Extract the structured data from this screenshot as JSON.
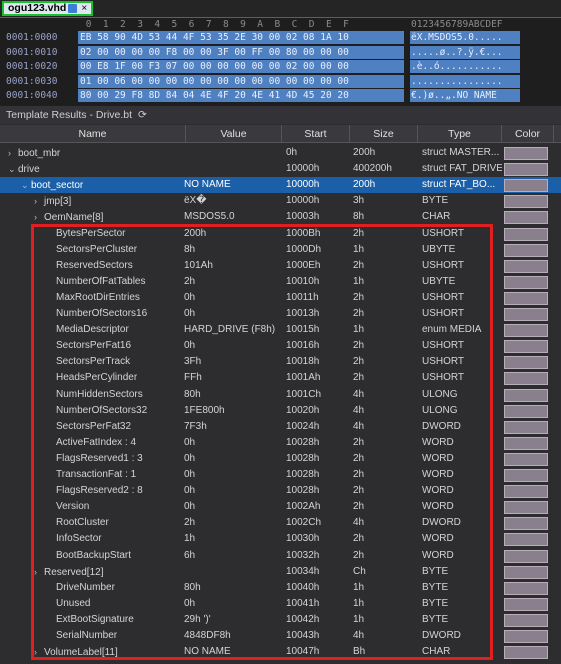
{
  "tab": {
    "label": "ogu123.vhd",
    "close": "×"
  },
  "hex": {
    "header": {
      "addr": "",
      "bytes": " 0  1  2  3  4  5  6  7  8  9  A  B  C  D  E  F",
      "ascii": "0123456789ABCDEF"
    },
    "rows": [
      {
        "addr": "0001:0000",
        "bytes": "EB 58 90 4D 53 44 4F 53 35 2E 30 00 02 08 1A 10",
        "ascii": "ëX.MSDOS5.0....."
      },
      {
        "addr": "0001:0010",
        "bytes": "02 00 00 00 00 F8 00 00 3F 00 FF 00 80 00 00 00",
        "ascii": ".....ø..?.ÿ.€..."
      },
      {
        "addr": "0001:0020",
        "bytes": "00 E8 1F 00 F3 07 00 00 00 00 00 00 02 00 00 00",
        "ascii": ".è..ó..........."
      },
      {
        "addr": "0001:0030",
        "bytes": "01 00 06 00 00 00 00 00 00 00 00 00 00 00 00 00",
        "ascii": "................"
      },
      {
        "addr": "0001:0040",
        "bytes": "80 00 29 F8 8D 84 04 4E 4F 20 4E 41 4D 45 20 20",
        "ascii": "€.)ø..„.NO NAME"
      }
    ]
  },
  "template_title": "Template Results - Drive.bt",
  "columns": [
    "Name",
    "Value",
    "Start",
    "Size",
    "Type",
    "Color"
  ],
  "rows": [
    {
      "indent": 0,
      "chev": "›",
      "name": "boot_mbr",
      "value": "",
      "start": "0h",
      "size": "200h",
      "type": "struct MASTER..."
    },
    {
      "indent": 0,
      "chev": "⌄",
      "name": "drive",
      "value": "",
      "start": "10000h",
      "size": "400200h",
      "type": "struct FAT_DRIVE"
    },
    {
      "indent": 1,
      "chev": "⌄",
      "name": "boot_sector",
      "value": "NO NAME",
      "start": "10000h",
      "size": "200h",
      "type": "struct FAT_BO...",
      "selected": true
    },
    {
      "indent": 2,
      "chev": "›",
      "name": "jmp[3]",
      "value": "ëX�",
      "start": "10000h",
      "size": "3h",
      "type": "BYTE"
    },
    {
      "indent": 2,
      "chev": "›",
      "name": "OemName[8]",
      "value": "MSDOS5.0",
      "start": "10003h",
      "size": "8h",
      "type": "CHAR"
    },
    {
      "indent": 3,
      "chev": "",
      "name": "BytesPerSector",
      "value": "200h",
      "start": "1000Bh",
      "size": "2h",
      "type": "USHORT"
    },
    {
      "indent": 3,
      "chev": "",
      "name": "SectorsPerCluster",
      "value": "8h",
      "start": "1000Dh",
      "size": "1h",
      "type": "UBYTE"
    },
    {
      "indent": 3,
      "chev": "",
      "name": "ReservedSectors",
      "value": "101Ah",
      "start": "1000Eh",
      "size": "2h",
      "type": "USHORT"
    },
    {
      "indent": 3,
      "chev": "",
      "name": "NumberOfFatTables",
      "value": "2h",
      "start": "10010h",
      "size": "1h",
      "type": "UBYTE"
    },
    {
      "indent": 3,
      "chev": "",
      "name": "MaxRootDirEntries",
      "value": "0h",
      "start": "10011h",
      "size": "2h",
      "type": "USHORT"
    },
    {
      "indent": 3,
      "chev": "",
      "name": "NumberOfSectors16",
      "value": "0h",
      "start": "10013h",
      "size": "2h",
      "type": "USHORT"
    },
    {
      "indent": 3,
      "chev": "",
      "name": "MediaDescriptor",
      "value": "HARD_DRIVE (F8h)",
      "start": "10015h",
      "size": "1h",
      "type": "enum MEDIA"
    },
    {
      "indent": 3,
      "chev": "",
      "name": "SectorsPerFat16",
      "value": "0h",
      "start": "10016h",
      "size": "2h",
      "type": "USHORT"
    },
    {
      "indent": 3,
      "chev": "",
      "name": "SectorsPerTrack",
      "value": "3Fh",
      "start": "10018h",
      "size": "2h",
      "type": "USHORT"
    },
    {
      "indent": 3,
      "chev": "",
      "name": "HeadsPerCylinder",
      "value": "FFh",
      "start": "1001Ah",
      "size": "2h",
      "type": "USHORT"
    },
    {
      "indent": 3,
      "chev": "",
      "name": "NumHiddenSectors",
      "value": "80h",
      "start": "1001Ch",
      "size": "4h",
      "type": "ULONG"
    },
    {
      "indent": 3,
      "chev": "",
      "name": "NumberOfSectors32",
      "value": "1FE800h",
      "start": "10020h",
      "size": "4h",
      "type": "ULONG"
    },
    {
      "indent": 3,
      "chev": "",
      "name": "SectorsPerFat32",
      "value": "7F3h",
      "start": "10024h",
      "size": "4h",
      "type": "DWORD"
    },
    {
      "indent": 3,
      "chev": "",
      "name": "ActiveFatIndex : 4",
      "value": "0h",
      "start": "10028h",
      "size": "2h",
      "type": "WORD"
    },
    {
      "indent": 3,
      "chev": "",
      "name": "FlagsReserved1 : 3",
      "value": "0h",
      "start": "10028h",
      "size": "2h",
      "type": "WORD"
    },
    {
      "indent": 3,
      "chev": "",
      "name": "TransactionFat : 1",
      "value": "0h",
      "start": "10028h",
      "size": "2h",
      "type": "WORD"
    },
    {
      "indent": 3,
      "chev": "",
      "name": "FlagsReserved2 : 8",
      "value": "0h",
      "start": "10028h",
      "size": "2h",
      "type": "WORD"
    },
    {
      "indent": 3,
      "chev": "",
      "name": "Version",
      "value": "0h",
      "start": "1002Ah",
      "size": "2h",
      "type": "WORD"
    },
    {
      "indent": 3,
      "chev": "",
      "name": "RootCluster",
      "value": "2h",
      "start": "1002Ch",
      "size": "4h",
      "type": "DWORD"
    },
    {
      "indent": 3,
      "chev": "",
      "name": "InfoSector",
      "value": "1h",
      "start": "10030h",
      "size": "2h",
      "type": "WORD"
    },
    {
      "indent": 3,
      "chev": "",
      "name": "BootBackupStart",
      "value": "6h",
      "start": "10032h",
      "size": "2h",
      "type": "WORD"
    },
    {
      "indent": 2,
      "chev": "›",
      "name": "Reserved[12]",
      "value": "",
      "start": "10034h",
      "size": "Ch",
      "type": "BYTE"
    },
    {
      "indent": 3,
      "chev": "",
      "name": "DriveNumber",
      "value": "80h",
      "start": "10040h",
      "size": "1h",
      "type": "BYTE"
    },
    {
      "indent": 3,
      "chev": "",
      "name": "Unused",
      "value": "0h",
      "start": "10041h",
      "size": "1h",
      "type": "BYTE"
    },
    {
      "indent": 3,
      "chev": "",
      "name": "ExtBootSignature",
      "value": "29h ')'",
      "start": "10042h",
      "size": "1h",
      "type": "BYTE"
    },
    {
      "indent": 3,
      "chev": "",
      "name": "SerialNumber",
      "value": "4848DF8h",
      "start": "10043h",
      "size": "4h",
      "type": "DWORD"
    },
    {
      "indent": 2,
      "chev": "›",
      "name": "VolumeLabel[11]",
      "value": "NO NAME",
      "start": "10047h",
      "size": "Bh",
      "type": "CHAR"
    }
  ],
  "colors": {
    "selected_row": "#1b5fa8",
    "hex_selection": "#4f81c2",
    "highlight_box": "#e02020",
    "tab_border": "#19c12f"
  }
}
